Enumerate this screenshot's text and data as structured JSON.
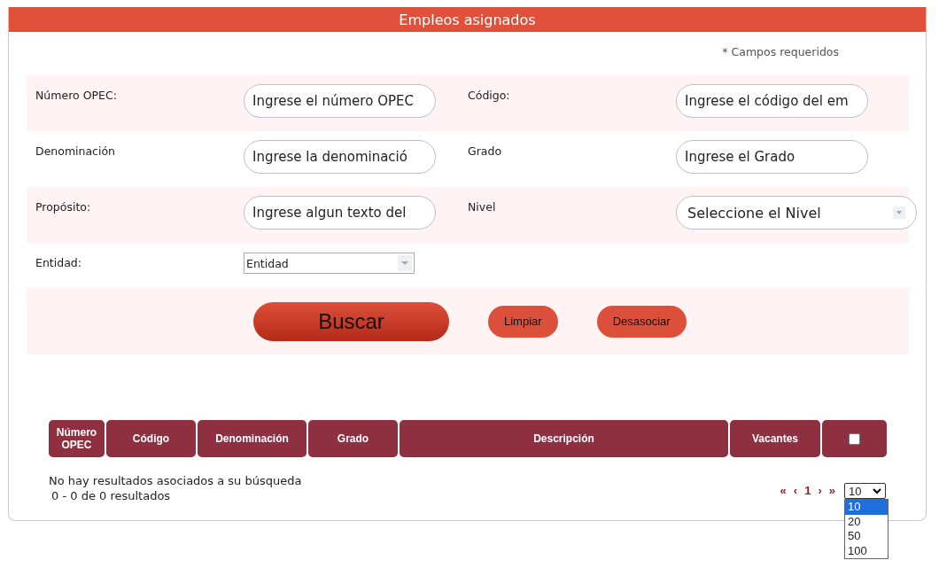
{
  "header": {
    "title": "Empleos asignados"
  },
  "required_note": "* Campos requeridos",
  "form_rows": [
    {
      "fields": [
        {
          "label": "Número OPEC:",
          "kind": "text",
          "placeholder": "Ingrese el número OPEC"
        },
        {
          "label": "Código:",
          "kind": "text",
          "placeholder": "Ingrese el código del em"
        }
      ]
    },
    {
      "fields": [
        {
          "label": "Denominación",
          "kind": "text",
          "placeholder": "Ingrese la denominació"
        },
        {
          "label": "Grado",
          "kind": "text",
          "placeholder": "Ingrese el Grado"
        }
      ]
    },
    {
      "fields": [
        {
          "label": "Propósito:",
          "kind": "text",
          "placeholder": "Ingrese algun texto del"
        },
        {
          "label": "Nivel",
          "kind": "select",
          "value": "Seleccione el Nivel"
        }
      ]
    },
    {
      "fields": [
        {
          "label": "Entidad:",
          "kind": "combo",
          "value": "Entidad"
        }
      ]
    }
  ],
  "buttons": [
    {
      "label": "Buscar",
      "kind": "primary"
    },
    {
      "label": "Limpiar",
      "kind": "secondary"
    },
    {
      "label": "Desasociar",
      "kind": "secondary"
    }
  ],
  "table": {
    "columns": [
      {
        "label": "Número OPEC",
        "kind": "text"
      },
      {
        "label": "Código",
        "kind": "text"
      },
      {
        "label": "Denominación",
        "kind": "text"
      },
      {
        "label": "Grado",
        "kind": "text"
      },
      {
        "label": "Descripción",
        "kind": "text"
      },
      {
        "label": "Vacantes",
        "kind": "text"
      },
      {
        "kind": "checkbox",
        "checked": false
      }
    ]
  },
  "empty_message": "No hay resultados asociados a su búsqueda",
  "result_count": "0 - 0 de 0 resultados",
  "pagination": [
    "«",
    "‹",
    "1",
    "›",
    "»"
  ],
  "page_size": {
    "value": "10",
    "expanded": true,
    "options": [
      {
        "label": "10",
        "selected": true
      },
      {
        "label": "20",
        "selected": false
      },
      {
        "label": "50",
        "selected": false
      },
      {
        "label": "100",
        "selected": false
      }
    ]
  }
}
